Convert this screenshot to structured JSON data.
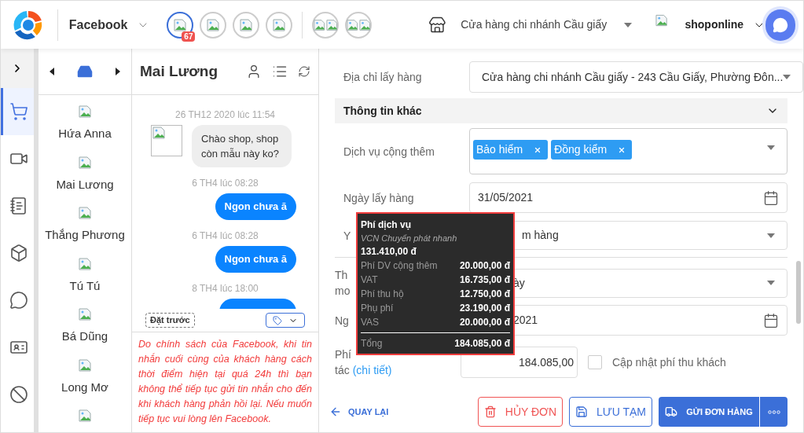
{
  "header": {
    "channel": "Facebook",
    "store": "Cửa hàng chi nhánh Cầu giấy",
    "account": "shoponline"
  },
  "page_avatars": [
    {
      "selected": true,
      "badge": "67"
    },
    {
      "selected": false
    },
    {
      "selected": false
    },
    {
      "selected": false
    }
  ],
  "nav_rail": [
    {
      "kind": "cart",
      "selected": true
    },
    {
      "kind": "video",
      "selected": false
    },
    {
      "kind": "note",
      "selected": false
    },
    {
      "kind": "box",
      "selected": false
    },
    {
      "kind": "messenger",
      "selected": false
    },
    {
      "kind": "card",
      "selected": false
    },
    {
      "kind": "blocked",
      "selected": false
    }
  ],
  "contacts": [
    {
      "name": "Hứa Anna"
    },
    {
      "name": "Mai Lương"
    },
    {
      "name": "Thắng Phương"
    },
    {
      "name": "Tú Tú"
    },
    {
      "name": "Bá Dũng"
    },
    {
      "name": "Long Mơ"
    }
  ],
  "chat": {
    "title": "Mai Lương",
    "messages": [
      {
        "time": "26 TH12 2020 lúc 11:54",
        "kind": "incoming",
        "text": "Chào shop, shop còn mẫu này ko?"
      },
      {
        "time": "6 TH4 lúc 08:28",
        "kind": "outgoing",
        "text": "Ngon chưa ă"
      },
      {
        "time": "6 TH4 lúc 08:28",
        "kind": "outgoing",
        "text": "Ngon chưa ă"
      },
      {
        "time": "8 TH4 lúc 18:00",
        "kind": "outgoing"
      }
    ],
    "tag": "Đặt trước",
    "notice": "Do chính sách của Facebook, khi tin nhắn cuối cùng của khách hàng cách thời điểm hiện tại quá 24h thì bạn không thể tiếp tục gửi tin nhắn cho đến khi khách hàng phản hồi lại. Nếu muốn tiếp tục vui lòng lên Facebook."
  },
  "form": {
    "pickup_address": {
      "label": "Địa chỉ lấy hàng",
      "value": "Cửa hàng chi nhánh Cầu giấy - 243 Cầu Giấy, Phường Đôn..."
    },
    "section": {
      "title": "Thông tin khác",
      "expanded": true
    },
    "services": {
      "label": "Dịch vụ cộng thêm",
      "tags": [
        "Bảo hiểm",
        "Đồng kiểm"
      ]
    },
    "pickup_date": {
      "label": "Ngày lấy hàng",
      "value": "31/05/2021"
    },
    "request": {
      "label": "Y",
      "value": "m hàng"
    },
    "delivery_time": {
      "label_lines": [
        "Th",
        "mo"
      ],
      "value": "ày"
    },
    "expected_date": {
      "label": "Ng",
      "value": "2021"
    },
    "fee": {
      "label_lines": [
        "Phí",
        "tác"
      ],
      "link": "(chi tiết)",
      "value": "184.085,00"
    },
    "update_fee": {
      "label": "Cập nhật phí thu khách",
      "checked": false
    }
  },
  "tooltip": {
    "title": "Phí dịch vụ",
    "service": "VCN Chuyển phát nhanh",
    "base": "131.410,00 đ",
    "rows": [
      {
        "label": "Phí DV cộng thêm",
        "value": "20.000,00 đ"
      },
      {
        "label": "VAT",
        "value": "16.735,00 đ"
      },
      {
        "label": "Phí thu hộ",
        "value": "12.750,00 đ"
      },
      {
        "label": "Phụ phí",
        "value": "23.190,00 đ"
      },
      {
        "label": "VAS",
        "value": "20.000,00 đ"
      }
    ],
    "total_label": "Tổng",
    "total": "184.085,00 đ"
  },
  "footer": {
    "back": "QUAY LẠI",
    "cancel": "HỦY ĐƠN",
    "save": "LƯU TẠM",
    "send": "GỬI ĐƠN HÀNG"
  }
}
